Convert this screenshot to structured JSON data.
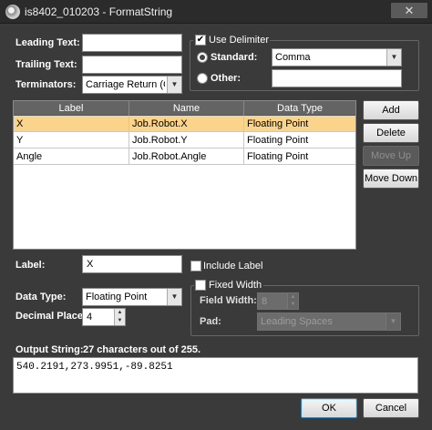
{
  "window": {
    "title": "is8402_010203 - FormatString",
    "close_glyph": "✕",
    "icon": "app-gear-icon"
  },
  "fields": {
    "leading_text_label": "Leading Text:",
    "leading_text_value": "",
    "trailing_text_label": "Trailing Text:",
    "trailing_text_value": "",
    "terminators_label": "Terminators:",
    "terminators_value": "Carriage Return (CR)"
  },
  "delimiter": {
    "use_label": "Use Delimiter",
    "use_checked": true,
    "standard_label": "Standard:",
    "standard_value": "Comma",
    "other_label": "Other:",
    "other_value": ""
  },
  "table": {
    "columns": [
      "Label",
      "Name",
      "Data Type"
    ],
    "rows": [
      {
        "label": "X",
        "name": "Job.Robot.X",
        "type": "Floating Point",
        "selected": true
      },
      {
        "label": "Y",
        "name": "Job.Robot.Y",
        "type": "Floating Point",
        "selected": false
      },
      {
        "label": "Angle",
        "name": "Job.Robot.Angle",
        "type": "Floating Point",
        "selected": false
      }
    ]
  },
  "buttons": {
    "add": "Add",
    "delete": "Delete",
    "move_up": "Move Up",
    "move_down": "Move Down",
    "ok": "OK",
    "cancel": "Cancel"
  },
  "item": {
    "label_label": "Label:",
    "label_value": "X",
    "include_label": "Include Label",
    "data_type_label": "Data Type:",
    "data_type_value": "Floating Point",
    "decimal_places_label": "Decimal Places:",
    "decimal_places_value": "4"
  },
  "fixed_width": {
    "label": "Fixed Width",
    "field_width_label": "Field Width:",
    "field_width_value": "8",
    "pad_label": "Pad:",
    "pad_value": "Leading Spaces"
  },
  "output": {
    "label": "Output String:",
    "count": "27 characters out of 255.",
    "value": "540.2191,273.9951,-89.8251"
  }
}
